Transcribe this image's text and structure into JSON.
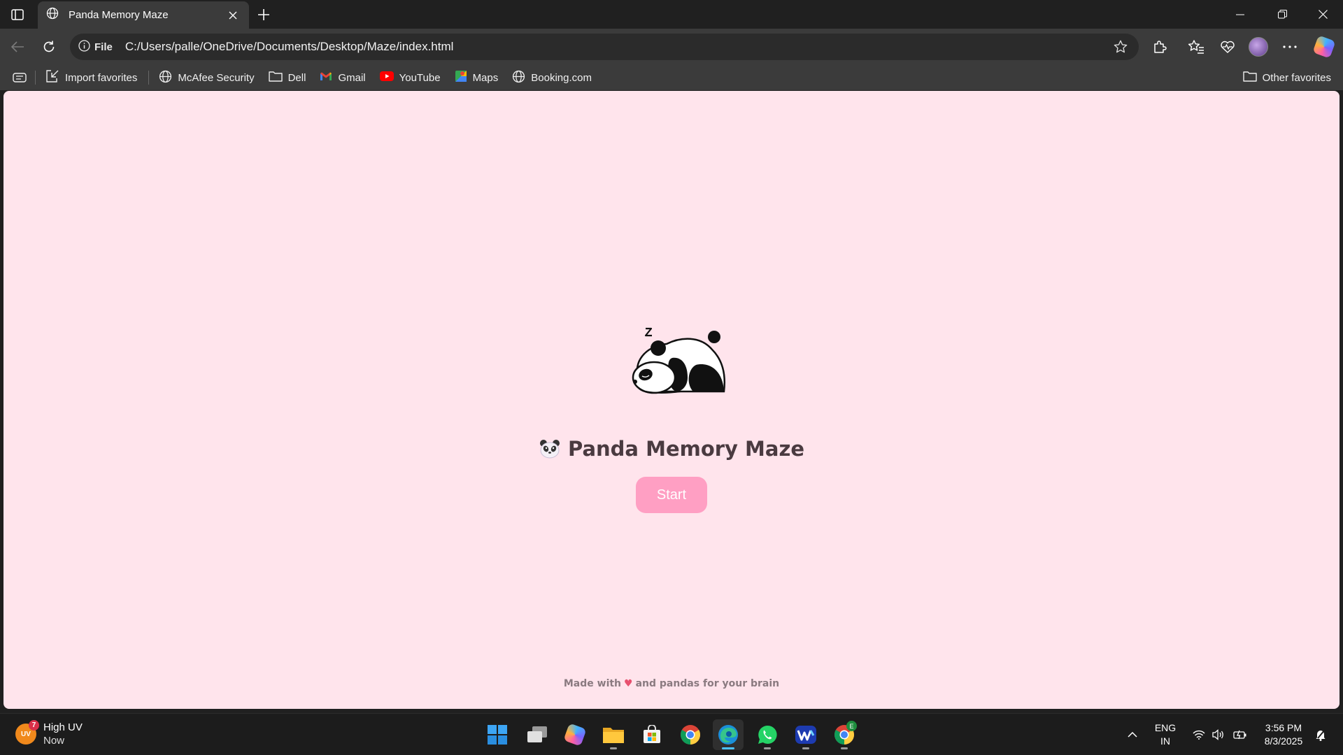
{
  "browser": {
    "tab": {
      "title": "Panda Memory Maze"
    },
    "address": {
      "scheme_label": "File",
      "url": "C:/Users/palle/OneDrive/Documents/Desktop/Maze/index.html"
    },
    "bookmarks": [
      {
        "label": "Import favorites",
        "icon": "import-icon"
      },
      {
        "label": "McAfee Security",
        "icon": "globe-icon"
      },
      {
        "label": "Dell",
        "icon": "folder-icon"
      },
      {
        "label": "Gmail",
        "icon": "gmail-icon"
      },
      {
        "label": "YouTube",
        "icon": "youtube-icon"
      },
      {
        "label": "Maps",
        "icon": "maps-icon"
      },
      {
        "label": "Booking.com",
        "icon": "globe-icon"
      }
    ],
    "other_favorites": "Other favorites"
  },
  "page": {
    "title": "Panda Memory Maze",
    "start_label": "Start",
    "footer_prefix": "Made with",
    "footer_suffix": "and pandas for your brain",
    "background": "#ffe4ec",
    "button_color": "#ff9fc3"
  },
  "taskbar": {
    "weather": {
      "uv_label": "UV",
      "badge": "7",
      "title": "High UV",
      "sub": "Now"
    },
    "apps": [
      "start-icon",
      "task-view-icon",
      "copilot-icon",
      "file-explorer-icon",
      "microsoft-store-icon",
      "chrome-icon",
      "edge-icon",
      "whatsapp-icon",
      "webex-icon",
      "chrome-profile-icon"
    ],
    "chrome_profile_badge": "E",
    "language": {
      "line1": "ENG",
      "line2": "IN"
    },
    "clock": {
      "time": "3:56 PM",
      "date": "8/3/2025"
    }
  }
}
